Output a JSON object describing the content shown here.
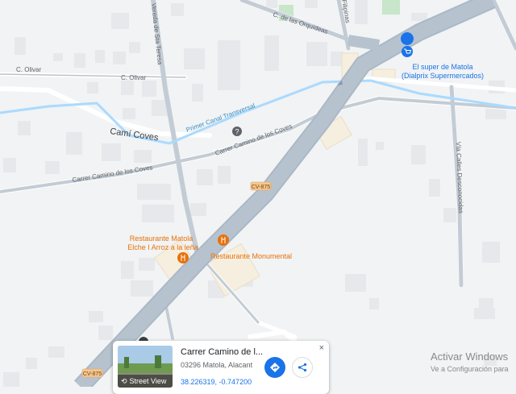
{
  "map": {
    "streets": {
      "olivar_1": "C. Olivar",
      "olivar_2": "C. Olivar",
      "cami_coves": "Camí Coves",
      "canal": "Primer Canal Transversal",
      "camino_coves_upper": "Carrer Camino de los Coves",
      "camino_coves_lower": "Carrer Camino de los Coves",
      "vereda": "Vereda de Sta Teresa",
      "orquideas": "C. de las Orquídeas",
      "filipinas": "Filipinas",
      "calles_desconocidas": "Vía Calles Desconocidas"
    },
    "road_shields": [
      "CV-875",
      "CV-875"
    ],
    "pois": {
      "supermarket_line1": "El super de Matola",
      "supermarket_line2": "(Dialprix Supermercados)",
      "restaurant_matola_line1": "Restaurante Matola",
      "restaurant_matola_line2": "Elche I Arroz a la leña",
      "restaurant_monumental": "Restaurante Monumental"
    },
    "colors": {
      "background": "#f1f3f4",
      "road": "#ffffff",
      "highway": "#aab8c6",
      "canal": "#aadaff",
      "food_poi": "#e8710a",
      "shop_poi": "#1a73e8",
      "park": "#c8e6c9"
    }
  },
  "info_card": {
    "title": "Carrer Camino de l...",
    "address": "03296 Matola, Alacant",
    "coordinates": "38.226319, -0.747200",
    "street_view_label": "Street View",
    "close_icon": "×"
  },
  "watermark": {
    "line1": "Activar Windows",
    "line2": "Ve a Configuración para"
  }
}
